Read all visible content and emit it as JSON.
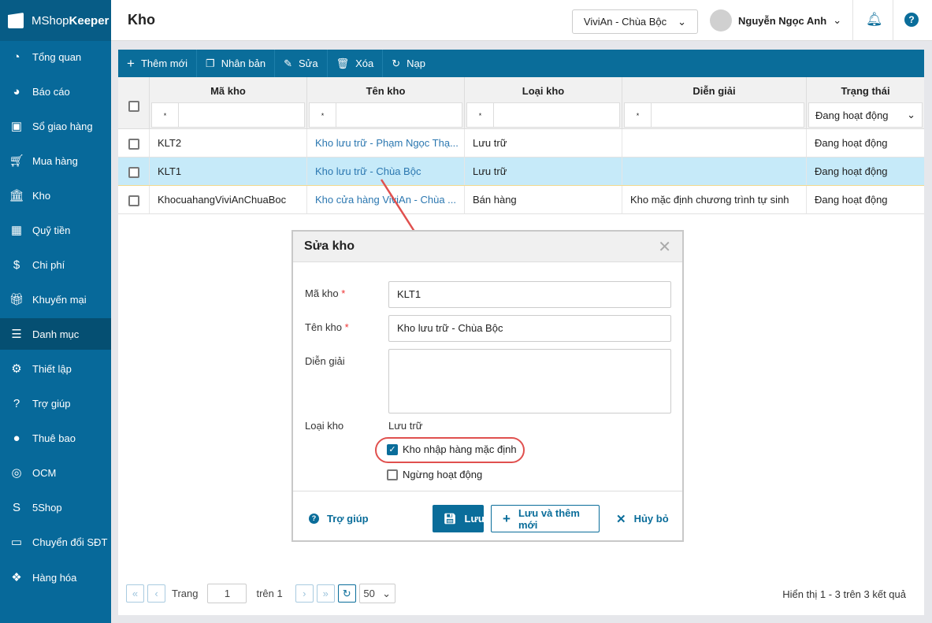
{
  "app": {
    "brand_light": "MShop",
    "brand_bold": "Keeper",
    "page_title": "Kho"
  },
  "sidebar": {
    "items": [
      {
        "label": "Tổng quan",
        "icon": "dashboard-icon"
      },
      {
        "label": "Báo cáo",
        "icon": "pie-chart-icon"
      },
      {
        "label": "Sổ giao hàng",
        "icon": "delivery-icon"
      },
      {
        "label": "Mua hàng",
        "icon": "cart-icon"
      },
      {
        "label": "Kho",
        "icon": "warehouse-icon"
      },
      {
        "label": "Quỹ tiền",
        "icon": "safe-icon"
      },
      {
        "label": "Chi phí",
        "icon": "money-icon"
      },
      {
        "label": "Khuyến mại",
        "icon": "gift-icon"
      },
      {
        "label": "Danh mục",
        "icon": "list-icon"
      },
      {
        "label": "Thiết lập",
        "icon": "gear-icon"
      },
      {
        "label": "Trợ giúp",
        "icon": "help-icon"
      },
      {
        "label": "Thuê bao",
        "icon": "user-icon"
      },
      {
        "label": "OCM",
        "icon": "ocm-icon"
      },
      {
        "label": "5Shop",
        "icon": "5shop-icon"
      },
      {
        "label": "Chuyển đổi SĐT",
        "icon": "phone-convert-icon"
      },
      {
        "label": "Hàng hóa",
        "icon": "boxes-icon"
      }
    ],
    "active": "Danh mục"
  },
  "header": {
    "store": "ViviAn - Chùa Bộc",
    "user": "Nguyễn Ngọc Anh"
  },
  "toolbar": {
    "add": "Thêm mới",
    "duplicate": "Nhân bản",
    "edit": "Sửa",
    "delete": "Xóa",
    "reload": "Nạp"
  },
  "table": {
    "columns": [
      "Mã kho",
      "Tên kho",
      "Loại kho",
      "Diễn giải",
      "Trạng thái"
    ],
    "filter_op": "*",
    "status_filter": "Đang hoạt động",
    "rows": [
      {
        "code": "KLT2",
        "name": "Kho lưu trữ - Phạm Ngọc Thạ...",
        "type": "Lưu trữ",
        "desc": "",
        "status": "Đang hoạt động"
      },
      {
        "code": "KLT1",
        "name": "Kho lưu trữ - Chùa Bộc",
        "type": "Lưu trữ",
        "desc": "",
        "status": "Đang hoạt động"
      },
      {
        "code": "KhocuahangViviAnChuaBoc",
        "name": "Kho cửa hàng ViviAn - Chùa ...",
        "type": "Bán hàng",
        "desc": "Kho mặc định chương trình tự sinh",
        "status": "Đang hoạt động"
      }
    ]
  },
  "pager": {
    "first": "«",
    "prev": "‹",
    "page_label": "Trang",
    "page": "1",
    "of_label": "trên 1",
    "next": "›",
    "last": "»",
    "page_size": "50",
    "result": "Hiển thị 1 - 3 trên 3 kết quả"
  },
  "dialog": {
    "title": "Sửa kho",
    "code_label": "Mã kho",
    "code": "KLT1",
    "name_label": "Tên kho",
    "name": "Kho lưu trữ - Chùa Bộc",
    "desc_label": "Diễn giải",
    "desc": "",
    "type_label": "Loại kho",
    "type": "Lưu trữ",
    "default_label": "Kho nhập hàng mặc định",
    "default_checked": true,
    "inactive_label": "Ngừng hoạt động",
    "inactive_checked": false,
    "help": "Trợ giúp",
    "save": "Lưu",
    "save_new": "Lưu và thêm mới",
    "cancel": "Hủy bỏ",
    "required": "*"
  },
  "colors": {
    "primary": "#0a6d9a",
    "sidebar": "#07699a",
    "selected_row": "#c6eaf9",
    "annotation": "#e0504e"
  }
}
